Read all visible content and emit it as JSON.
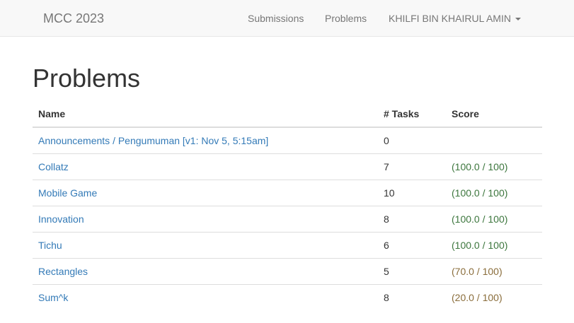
{
  "navbar": {
    "brand": "MCC 2023",
    "submissions_label": "Submissions",
    "problems_label": "Problems",
    "user_label": "KHILFI BIN KHAIRUL AMIN"
  },
  "page": {
    "title": "Problems"
  },
  "table": {
    "headers": {
      "name": "Name",
      "tasks": "# Tasks",
      "score": "Score"
    },
    "rows": [
      {
        "name": "Announcements / Pengumuman [v1: Nov 5, 5:15am]",
        "tasks": "0",
        "score": ""
      },
      {
        "name": "Collatz",
        "tasks": "7",
        "score": "(100.0 / 100)"
      },
      {
        "name": "Mobile Game",
        "tasks": "10",
        "score": "(100.0 / 100)"
      },
      {
        "name": "Innovation",
        "tasks": "8",
        "score": "(100.0 / 100)"
      },
      {
        "name": "Tichu",
        "tasks": "6",
        "score": "(100.0 / 100)"
      },
      {
        "name": "Rectangles",
        "tasks": "5",
        "score": "(70.0 / 100)"
      },
      {
        "name": "Sum^k",
        "tasks": "8",
        "score": "(20.0 / 100)"
      }
    ]
  },
  "colors": {
    "link": "#337ab7",
    "score_full": "#3c763d",
    "score_partial": "#8a6d3b",
    "navbar_bg": "#f8f8f8"
  }
}
